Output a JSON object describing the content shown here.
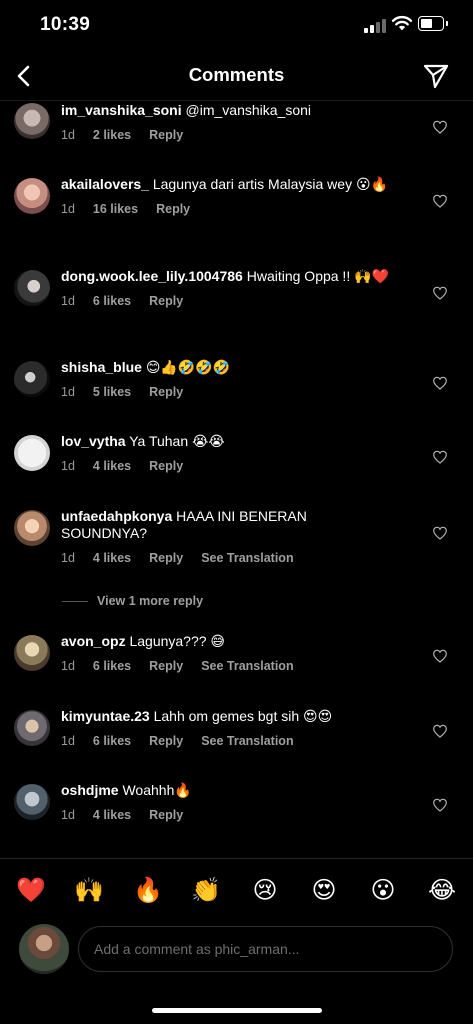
{
  "status_bar": {
    "time": "10:39"
  },
  "header": {
    "title": "Comments"
  },
  "comments": [
    {
      "username": "im_vanshika_soni",
      "text": "@im_vanshika_soni",
      "time": "1d",
      "likes": "2 likes",
      "reply": "Reply",
      "translate": ""
    },
    {
      "username": "akailalovers_",
      "text": "Lagunya dari artis Malaysia wey 😮🔥",
      "time": "1d",
      "likes": "16 likes",
      "reply": "Reply",
      "translate": ""
    },
    {
      "username": "dong.wook.lee_lily.1004786",
      "text": "Hwaiting Oppa !! 🙌❤️",
      "time": "1d",
      "likes": "6 likes",
      "reply": "Reply",
      "translate": ""
    },
    {
      "username": "shisha_blue",
      "text": "😊👍🤣🤣🤣",
      "time": "1d",
      "likes": "5 likes",
      "reply": "Reply",
      "translate": ""
    },
    {
      "username": "lov_vytha",
      "text": "Ya Tuhan 😭😭",
      "time": "1d",
      "likes": "4 likes",
      "reply": "Reply",
      "translate": ""
    },
    {
      "username": "unfaedahpkonya",
      "text": "HAAA INI BENERAN SOUNDNYA?",
      "time": "1d",
      "likes": "4 likes",
      "reply": "Reply",
      "translate": "See Translation"
    },
    {
      "username": "avon_opz",
      "text": "Lagunya??? 😅",
      "time": "1d",
      "likes": "6 likes",
      "reply": "Reply",
      "translate": "See Translation"
    },
    {
      "username": "kimyuntae.23",
      "text": "Lahh om gemes bgt sih 😍😍",
      "time": "1d",
      "likes": "6 likes",
      "reply": "Reply",
      "translate": "See Translation"
    },
    {
      "username": "oshdjme",
      "text": "Woahhh🔥",
      "time": "1d",
      "likes": "4 likes",
      "reply": "Reply",
      "translate": ""
    }
  ],
  "view_more_replies": "View 1 more reply",
  "quick_emojis": [
    "❤️",
    "🙌",
    "🔥",
    "👏",
    "😢",
    "😍",
    "😮",
    "😂"
  ],
  "composer": {
    "placeholder": "Add a comment as phic_arman..."
  },
  "colors": {
    "background": "#000000",
    "text": "#ffffff",
    "secondary_text": "#9a9a9a",
    "heart_red": "#ed4956"
  }
}
